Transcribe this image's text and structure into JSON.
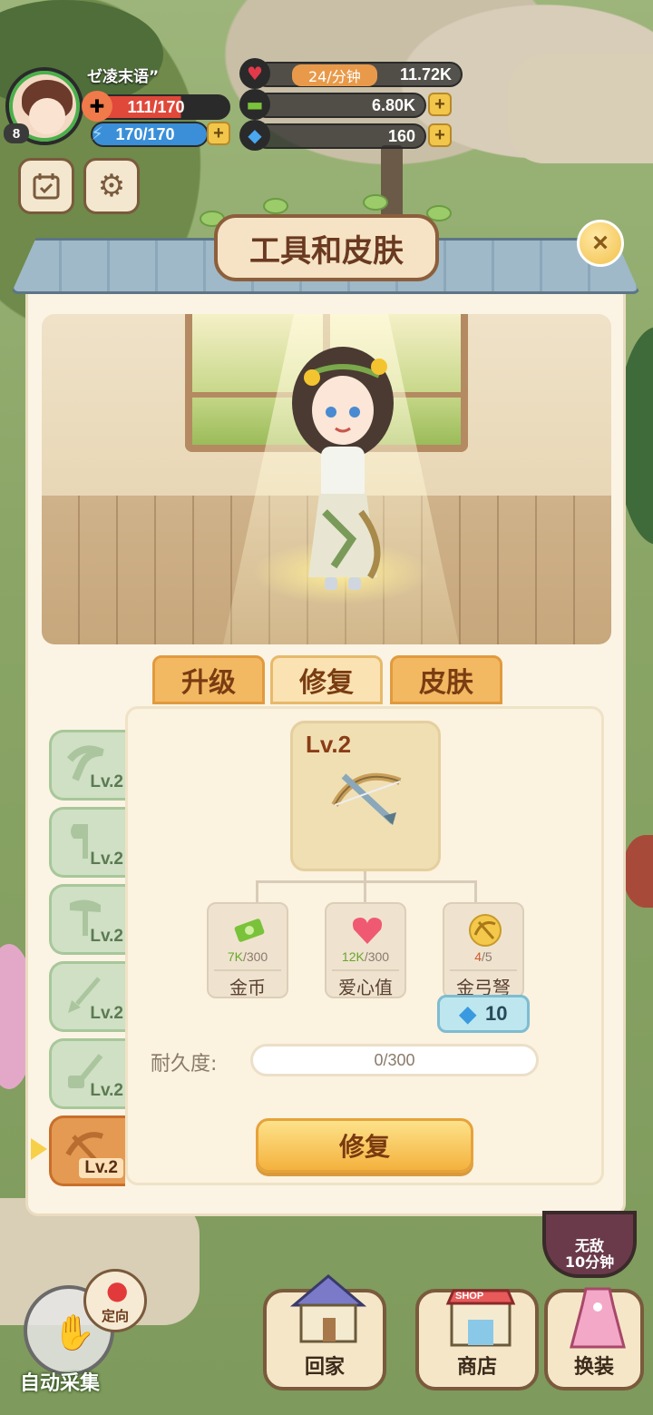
{
  "player": {
    "name": "ゼ凌末语”",
    "level": "8",
    "hp": "111/170",
    "energy": "170/170"
  },
  "resources": {
    "hearts_rate": "24/分钟",
    "hearts": "11.72K",
    "money": "6.80K",
    "gems": "160"
  },
  "dialog": {
    "title": "工具和皮肤",
    "close_icon": "×"
  },
  "tabs": [
    {
      "label": "升级"
    },
    {
      "label": "修复"
    },
    {
      "label": "皮肤"
    }
  ],
  "tools": [
    {
      "level": "Lv.2"
    },
    {
      "level": "Lv.2"
    },
    {
      "level": "Lv.2"
    },
    {
      "level": "Lv.2"
    },
    {
      "level": "Lv.2"
    },
    {
      "level": "Lv.2"
    }
  ],
  "selected_tool": {
    "level": "Lv.2"
  },
  "requirements": [
    {
      "have": "7K",
      "need": "/300",
      "name": "金币"
    },
    {
      "have": "12K",
      "need": "/300",
      "name": "爱心值"
    },
    {
      "have": "4",
      "need": "/5",
      "name": "金弓弩"
    }
  ],
  "gem_cost": "10",
  "durability": {
    "label": "耐久度:",
    "value": "0/300"
  },
  "repair_button": "修复",
  "bottom_nav": {
    "auto_collect": "自动采集",
    "locate": "定向",
    "invincible": "无敌\n10分钟",
    "home": "回家",
    "shop": "商店",
    "shop_sign": "SHOP",
    "dress": "换装"
  },
  "colors": {
    "panel_bg": "#fbf4e4",
    "tab_active": "#fbe2b2",
    "tab_inactive": "#f3b862",
    "accent_text": "#7a3d12"
  }
}
